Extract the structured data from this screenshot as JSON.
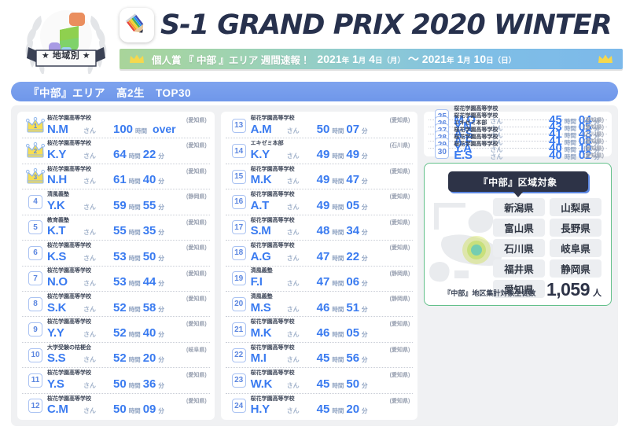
{
  "header": {
    "emblem_ribbon": "★ 地域別 ★",
    "app_icon": "pencil-icon",
    "main_title": "S-1 GRAND PRIX 2020 WINTER",
    "sub_crown_left": "crown-icon",
    "sub_crown_right": "crown-icon",
    "sub_text": "個人賞 『 中部 』エリア 週間速報！",
    "date_range": "2021年 1月 4日（月）〜 2021年 1月10日（日）",
    "date_parts": {
      "y1": "2021",
      "y1u": "年",
      "m1": "1",
      "m1u": "月",
      "d1": "4",
      "d1u": "日",
      "w1": "（月）",
      "tilde": "〜",
      "y2": "2021",
      "y2u": "年",
      "m2": "1",
      "m2u": "月",
      "d2": "10",
      "d2u": "日",
      "w2": "（日）"
    }
  },
  "section_title": "『中部』エリア　高2生　TOP30",
  "labels": {
    "san": "さん",
    "hour": "時間",
    "minute": "分",
    "over": "over"
  },
  "ranking": [
    {
      "rank": "1",
      "medal": "crown",
      "school": "桜花学園高等学校",
      "pref": "(愛知県)",
      "name": "N.M",
      "hours": "100",
      "minutes": "",
      "over": "over"
    },
    {
      "rank": "2",
      "medal": "crown",
      "school": "桜花学園高等学校",
      "pref": "(愛知県)",
      "name": "K.Y",
      "hours": "64",
      "minutes": "22",
      "over": ""
    },
    {
      "rank": "3",
      "medal": "crown",
      "school": "桜花学園高等学校",
      "pref": "(愛知県)",
      "name": "N.H",
      "hours": "61",
      "minutes": "40",
      "over": ""
    },
    {
      "rank": "4",
      "medal": "box",
      "school": "清風義塾",
      "pref": "(静岡県)",
      "name": "Y.K",
      "hours": "59",
      "minutes": "55",
      "over": ""
    },
    {
      "rank": "5",
      "medal": "box",
      "school": "教育義塾",
      "pref": "(愛知県)",
      "name": "K.T",
      "hours": "55",
      "minutes": "35",
      "over": ""
    },
    {
      "rank": "6",
      "medal": "box",
      "school": "桜花学園高等学校",
      "pref": "(愛知県)",
      "name": "K.S",
      "hours": "53",
      "minutes": "50",
      "over": ""
    },
    {
      "rank": "7",
      "medal": "box",
      "school": "桜花学園高等学校",
      "pref": "(愛知県)",
      "name": "N.O",
      "hours": "53",
      "minutes": "44",
      "over": ""
    },
    {
      "rank": "8",
      "medal": "box",
      "school": "桜花学園高等学校",
      "pref": "(愛知県)",
      "name": "S.K",
      "hours": "52",
      "minutes": "58",
      "over": ""
    },
    {
      "rank": "9",
      "medal": "box",
      "school": "桜花学園高等学校",
      "pref": "(愛知県)",
      "name": "Y.Y",
      "hours": "52",
      "minutes": "40",
      "over": ""
    },
    {
      "rank": "10",
      "medal": "box",
      "school": "大学受験の桔梗会",
      "pref": "(岐阜県)",
      "name": "S.S",
      "hours": "52",
      "minutes": "20",
      "over": ""
    },
    {
      "rank": "11",
      "medal": "box",
      "school": "桜花学園高等学校",
      "pref": "(愛知県)",
      "name": "Y.S",
      "hours": "50",
      "minutes": "36",
      "over": ""
    },
    {
      "rank": "12",
      "medal": "box",
      "school": "桜花学園高等学校",
      "pref": "(愛知県)",
      "name": "C.M",
      "hours": "50",
      "minutes": "09",
      "over": ""
    },
    {
      "rank": "13",
      "medal": "box",
      "school": "桜花学園高等学校",
      "pref": "(愛知県)",
      "name": "A.M",
      "hours": "50",
      "minutes": "07",
      "over": ""
    },
    {
      "rank": "14",
      "medal": "box",
      "school": "エキゼミ本部",
      "pref": "(石川県)",
      "name": "K.Y",
      "hours": "49",
      "minutes": "49",
      "over": ""
    },
    {
      "rank": "15",
      "medal": "box",
      "school": "桜花学園高等学校",
      "pref": "(愛知県)",
      "name": "M.K",
      "hours": "49",
      "minutes": "47",
      "over": ""
    },
    {
      "rank": "16",
      "medal": "box",
      "school": "桜花学園高等学校",
      "pref": "(愛知県)",
      "name": "A.T",
      "hours": "49",
      "minutes": "05",
      "over": ""
    },
    {
      "rank": "17",
      "medal": "box",
      "school": "桜花学園高等学校",
      "pref": "(愛知県)",
      "name": "S.M",
      "hours": "48",
      "minutes": "34",
      "over": ""
    },
    {
      "rank": "18",
      "medal": "box",
      "school": "桜花学園高等学校",
      "pref": "(愛知県)",
      "name": "A.G",
      "hours": "47",
      "minutes": "22",
      "over": ""
    },
    {
      "rank": "19",
      "medal": "box",
      "school": "清風義塾",
      "pref": "(静岡県)",
      "name": "F.I",
      "hours": "47",
      "minutes": "06",
      "over": ""
    },
    {
      "rank": "20",
      "medal": "box",
      "school": "清風義塾",
      "pref": "(静岡県)",
      "name": "M.S",
      "hours": "46",
      "minutes": "51",
      "over": ""
    },
    {
      "rank": "21",
      "medal": "box",
      "school": "桜花学園高等学校",
      "pref": "(愛知県)",
      "name": "M.K",
      "hours": "46",
      "minutes": "05",
      "over": ""
    },
    {
      "rank": "22",
      "medal": "box",
      "school": "桜花学園高等学校",
      "pref": "(愛知県)",
      "name": "M.I",
      "hours": "45",
      "minutes": "56",
      "over": ""
    },
    {
      "rank": "23",
      "medal": "box",
      "school": "桜花学園高等学校",
      "pref": "(愛知県)",
      "name": "W.K",
      "hours": "45",
      "minutes": "50",
      "over": ""
    },
    {
      "rank": "24",
      "medal": "box",
      "school": "桜花学園高等学校",
      "pref": "(愛知県)",
      "name": "H.Y",
      "hours": "45",
      "minutes": "20",
      "over": ""
    },
    {
      "rank": "25",
      "medal": "box",
      "school": "桜花学園高等学校",
      "pref": "(愛知県)",
      "name": "M.O",
      "hours": "45",
      "minutes": "04",
      "over": ""
    },
    {
      "rank": "26",
      "medal": "box",
      "school": "桜花学園高等学校",
      "pref": "(愛知県)",
      "name": "Y.N",
      "hours": "43",
      "minutes": "05",
      "over": ""
    },
    {
      "rank": "27",
      "medal": "box",
      "school": "エキゼミ本部",
      "pref": "(石川県)",
      "name": "A.S",
      "hours": "41",
      "minutes": "43",
      "over": ""
    },
    {
      "rank": "28",
      "medal": "box",
      "school": "桜花学園高等学校",
      "pref": "(愛知県)",
      "name": "A.F",
      "hours": "41",
      "minutes": "08",
      "over": ""
    },
    {
      "rank": "29",
      "medal": "box",
      "school": "桜花学園高等学校",
      "pref": "(愛知県)",
      "name": "Y.A",
      "hours": "40",
      "minutes": "10",
      "over": ""
    },
    {
      "rank": "30",
      "medal": "box",
      "school": "桜花学園高等学校",
      "pref": "(愛知県)",
      "name": "E.S",
      "hours": "40",
      "minutes": "02",
      "over": ""
    }
  ],
  "area_box": {
    "tag": "『中部』区域対象",
    "prefectures": [
      "新潟県",
      "山梨県",
      "富山県",
      "長野県",
      "石川県",
      "岐阜県",
      "福井県",
      "静岡県",
      "愛知県"
    ],
    "total_label": "『中部』地区集計対象生徒数",
    "total_number": "1,059",
    "total_unit": "人"
  },
  "colors": {
    "accent_blue": "#3a7bf0",
    "pill_blue": "#6f97ea",
    "dark_navy": "#2d3347",
    "green_border": "#63c08a",
    "crown_gold": "#f5d84e"
  }
}
